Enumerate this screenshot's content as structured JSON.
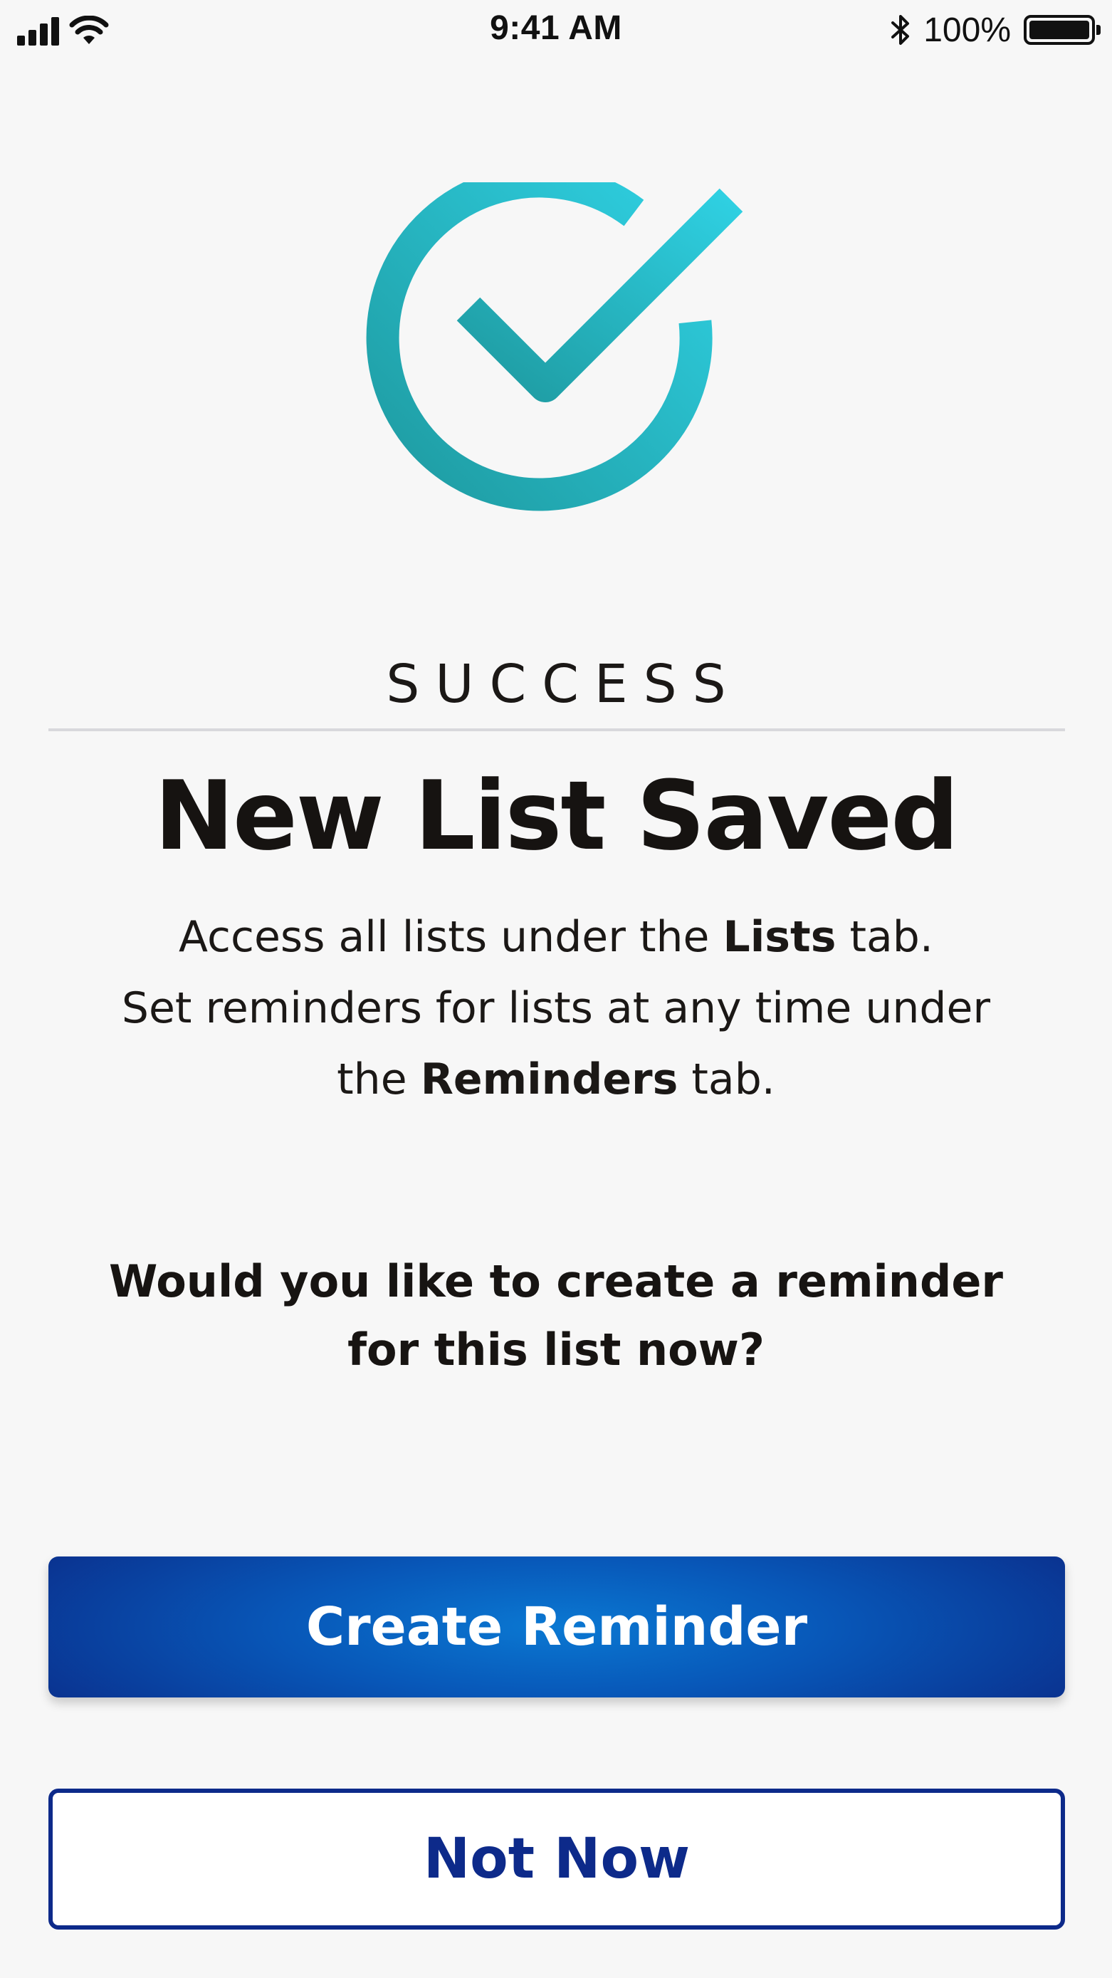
{
  "status_bar": {
    "time": "9:41 AM",
    "battery_percent": "100%",
    "battery_level": 1.0,
    "icons": [
      "cellular-signal-icon",
      "wifi-icon",
      "bluetooth-icon",
      "battery-icon"
    ]
  },
  "success_icon": {
    "name": "check-circle-icon",
    "gradient": [
      "#1e9aa0",
      "#2fd0e2"
    ]
  },
  "eyebrow": "SUCCESS",
  "headline": "New List Saved",
  "body": {
    "line1_prefix": "Access all lists under the ",
    "line1_bold": "Lists",
    "line1_suffix": " tab.",
    "line2": "Set reminders for lists at any time under",
    "line3_prefix": "the ",
    "line3_bold": "Reminders",
    "line3_suffix": " tab."
  },
  "question": {
    "line1": "Would you like to create a reminder",
    "line2": "for this list now?"
  },
  "buttons": {
    "primary_label": "Create Reminder",
    "secondary_label": "Not Now"
  },
  "colors": {
    "background": "#f7f7f7",
    "primary_button": "#0857b8",
    "secondary_border": "#0d2a8a",
    "accent_teal": "#2ab8c8"
  }
}
